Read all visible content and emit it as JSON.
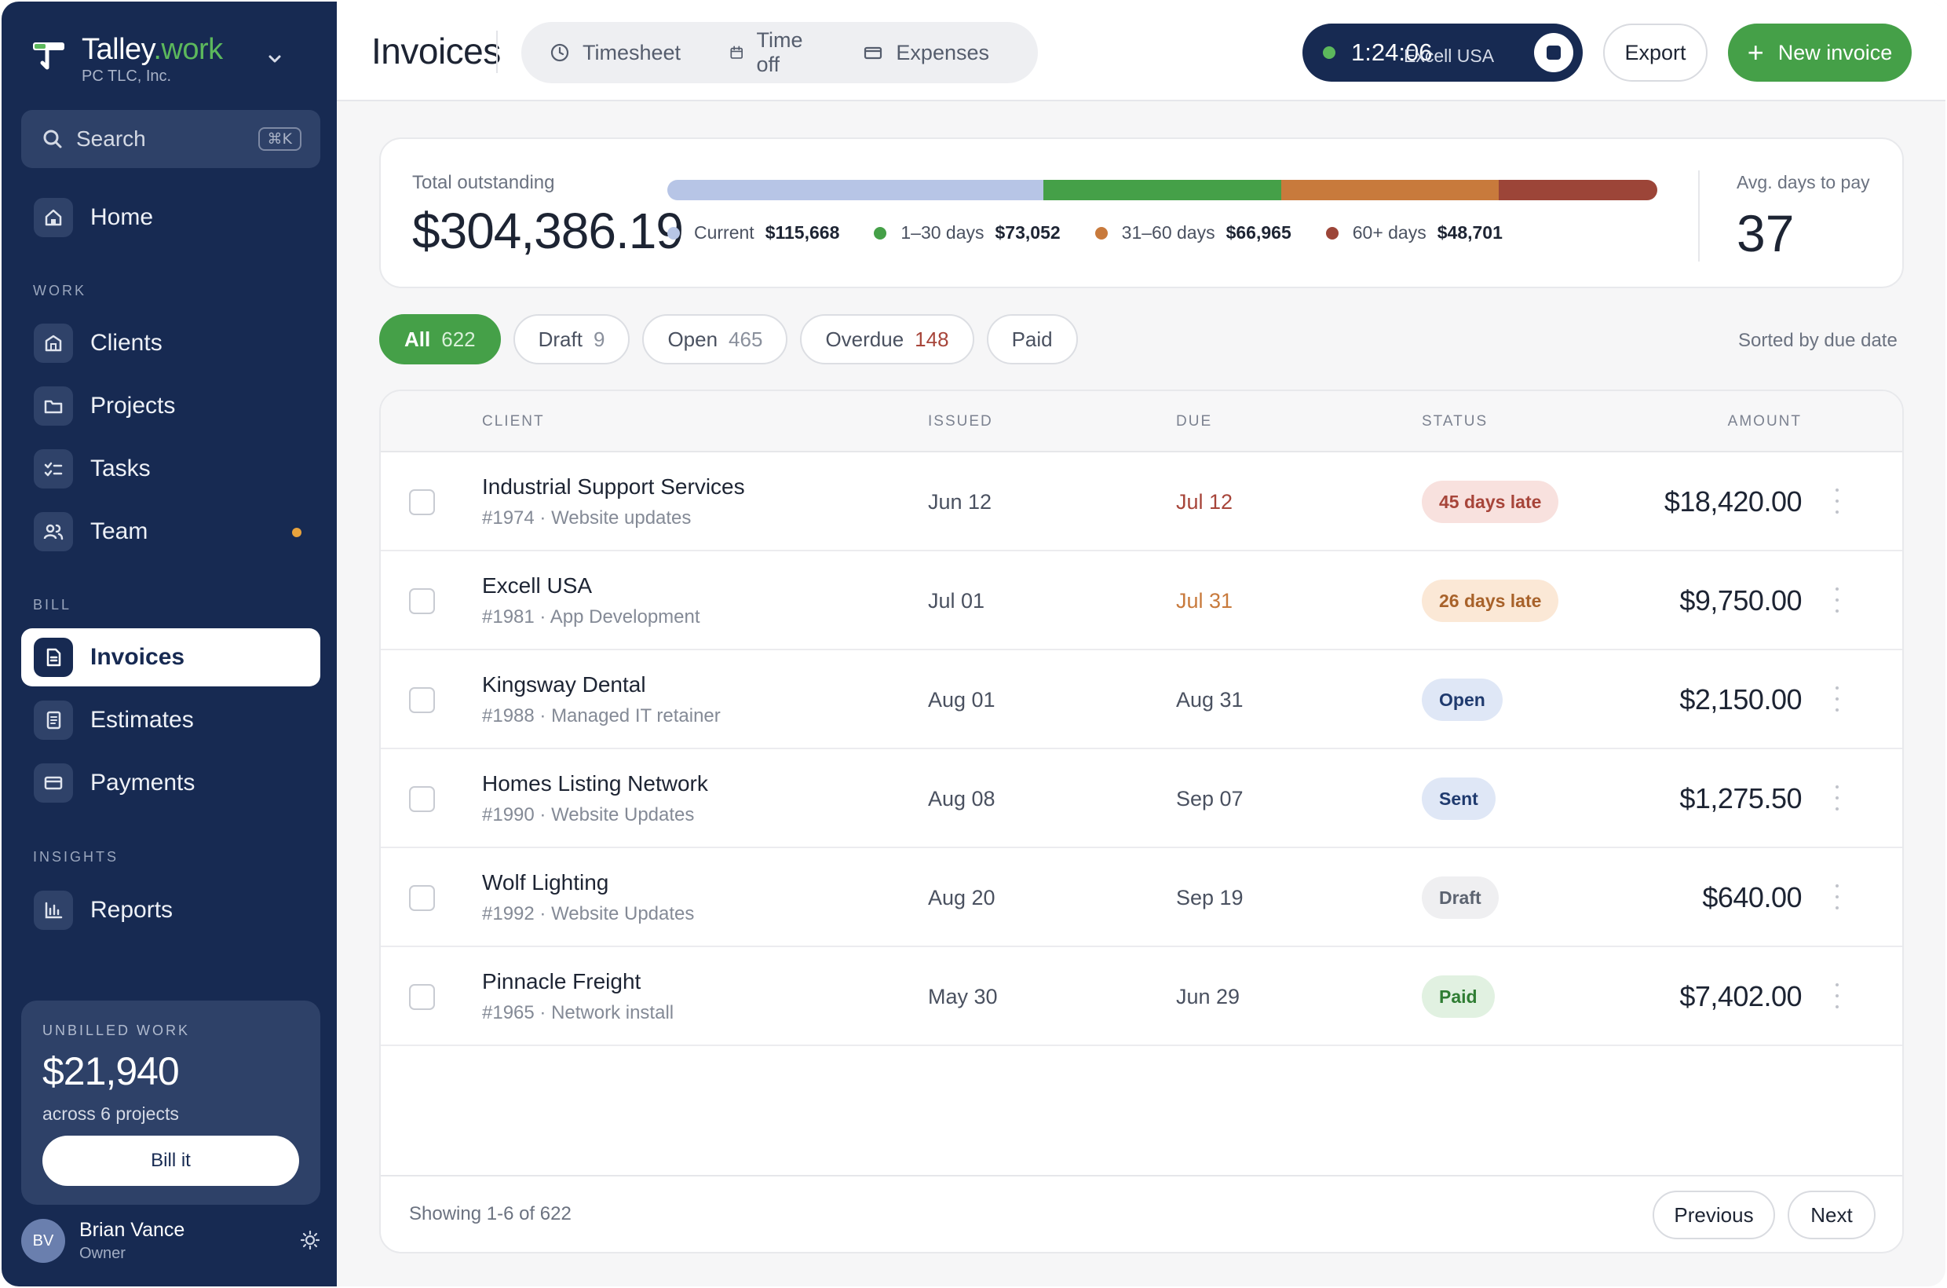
{
  "brand": {
    "name_main": "Talley",
    "name_accent": ".work",
    "org": "PC TLC, Inc."
  },
  "search": {
    "label": "Search",
    "shortcut": "⌘K"
  },
  "sidebar": {
    "home": "Home",
    "sections": {
      "work": "WORK",
      "bill": "BILL",
      "insights": "INSIGHTS"
    },
    "items": {
      "clients": "Clients",
      "projects": "Projects",
      "tasks": "Tasks",
      "team": "Team",
      "invoices": "Invoices",
      "estimates": "Estimates",
      "payments": "Payments",
      "reports": "Reports"
    },
    "unbilled": {
      "caption": "UNBILLED WORK",
      "amount": "$21,940",
      "desc": "across 6 projects",
      "button": "Bill it"
    },
    "user": {
      "initials": "BV",
      "name": "Brian Vance",
      "role": "Owner"
    }
  },
  "header": {
    "title": "Invoices",
    "tabs": [
      "Timesheet",
      "Time off",
      "Expenses"
    ],
    "timer": {
      "time": "1:24:06",
      "client": "Excell USA"
    },
    "export_label": "Export",
    "new_label": "New invoice"
  },
  "summary": {
    "total_label": "Total outstanding",
    "total_value": "$304,386.19",
    "avg_label": "Avg. days to pay",
    "avg_value": "37",
    "buckets": [
      {
        "label": "Current",
        "value": "$115,668",
        "amount": 115668,
        "color": "#b7c5e6"
      },
      {
        "label": "1–30 days",
        "value": "$73,052",
        "amount": 73052,
        "color": "#45a048"
      },
      {
        "label": "31–60 days",
        "value": "$66,965",
        "amount": 66965,
        "color": "#c87a3c"
      },
      {
        "label": "60+ days",
        "value": "$48,701",
        "amount": 48701,
        "color": "#9c4538"
      }
    ]
  },
  "filters": {
    "chips": [
      {
        "label": "All",
        "count": "622"
      },
      {
        "label": "Draft",
        "count": "9"
      },
      {
        "label": "Open",
        "count": "465"
      },
      {
        "label": "Overdue",
        "count": "148"
      },
      {
        "label": "Paid",
        "count": ""
      }
    ],
    "sorted": "Sorted by due date"
  },
  "table": {
    "headers": {
      "client": "CLIENT",
      "issued": "ISSUED",
      "due": "DUE",
      "status": "STATUS",
      "amount": "AMOUNT"
    },
    "rows": [
      {
        "client": "Industrial Support Services",
        "sub": "#1974 · Website updates",
        "issued": "Jun 12",
        "due": "Jul 12",
        "status": "45 days late",
        "amount": "$18,420.00"
      },
      {
        "client": "Excell USA",
        "sub": "#1981 · App Development",
        "issued": "Jul 01",
        "due": "Jul 31",
        "status": "26 days late",
        "amount": "$9,750.00"
      },
      {
        "client": "Kingsway Dental",
        "sub": "#1988 · Managed IT retainer",
        "issued": "Aug 01",
        "due": "Aug 31",
        "status": "Open",
        "amount": "$2,150.00"
      },
      {
        "client": "Homes Listing Network",
        "sub": "#1990 · Website Updates",
        "issued": "Aug 08",
        "due": "Sep 07",
        "status": "Sent",
        "amount": "$1,275.50"
      },
      {
        "client": "Wolf Lighting",
        "sub": "#1992 · Website Updates",
        "issued": "Aug 20",
        "due": "Sep 19",
        "status": "Draft",
        "amount": "$640.00"
      },
      {
        "client": "Pinnacle Freight",
        "sub": "#1965 · Network install",
        "issued": "May 30",
        "due": "Jun 29",
        "status": "Paid",
        "amount": "$7,402.00"
      }
    ],
    "footer": {
      "showing": "Showing 1-6 of 622",
      "prev": "Previous",
      "next": "Next"
    }
  },
  "colors": {
    "sidebar": "#172a52",
    "accent_green": "#45a048",
    "late_red_text": "#a7453a",
    "late_orange_text": "#c87a3c"
  }
}
